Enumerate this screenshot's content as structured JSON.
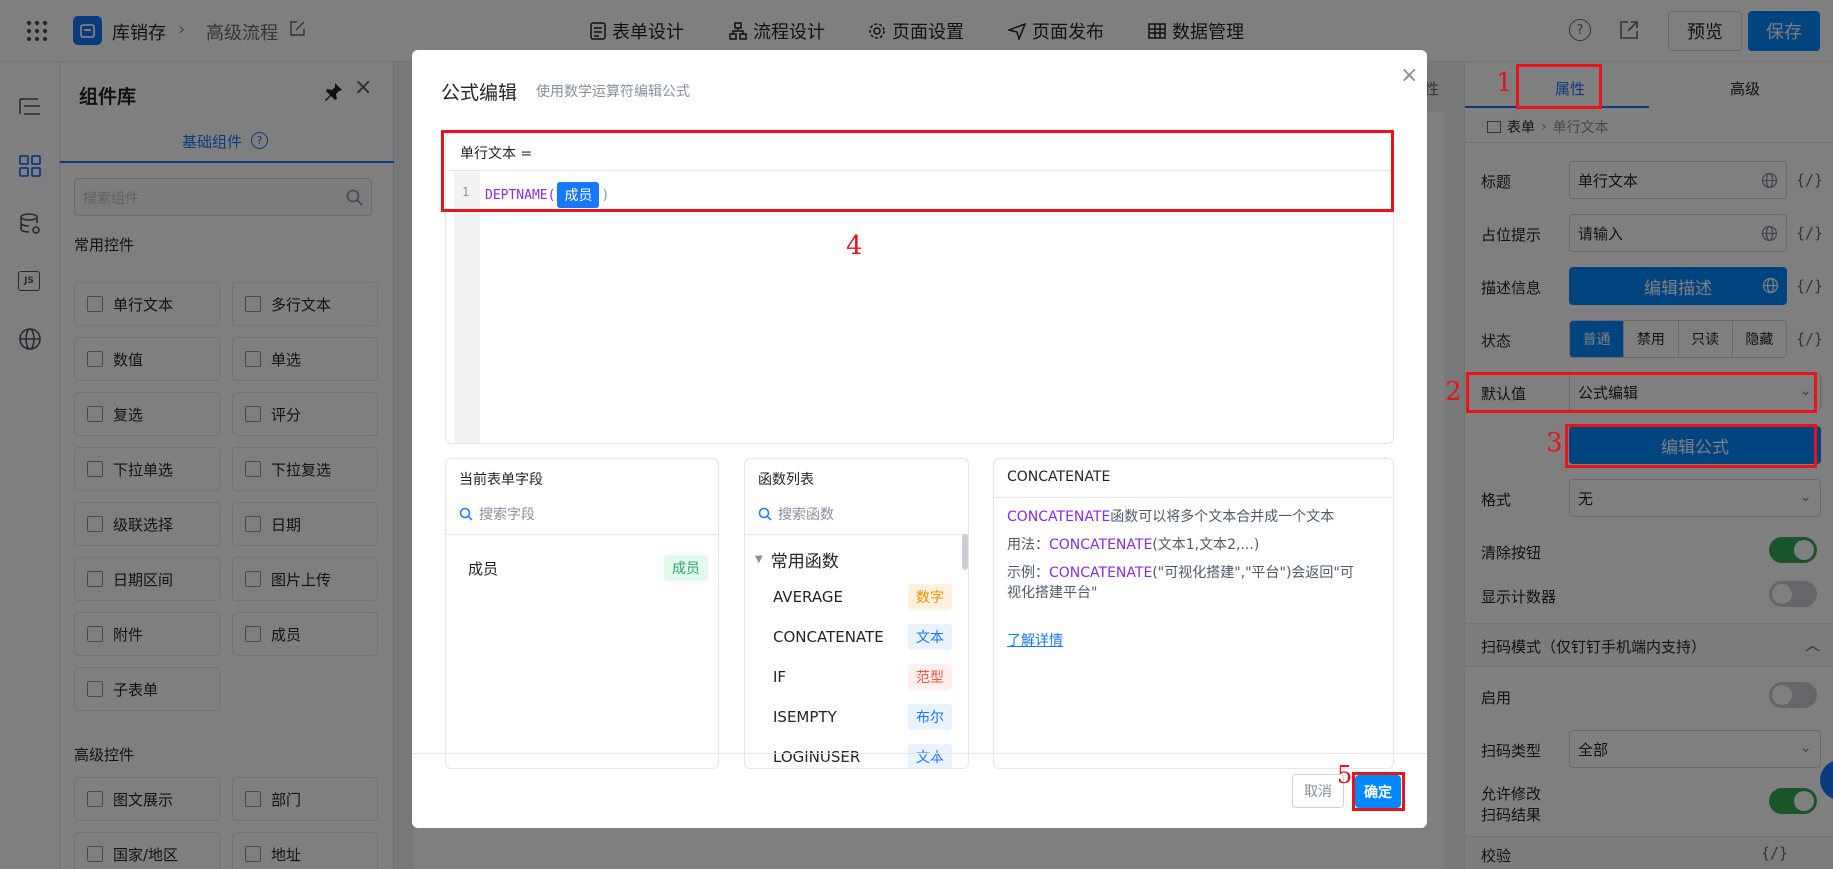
{
  "topbar": {
    "app_name": "库销存",
    "flow_name": "高级流程",
    "tabs": [
      "表单设计",
      "流程设计",
      "页面设置",
      "页面发布",
      "数据管理"
    ],
    "preview": "预览",
    "save": "保存"
  },
  "library": {
    "title": "组件库",
    "tab": "基础组件",
    "search_placeholder": "搜索组件",
    "common_title": "常用控件",
    "common": [
      "单行文本",
      "多行文本",
      "数值",
      "单选",
      "复选",
      "评分",
      "下拉单选",
      "下拉复选",
      "级联选择",
      "日期",
      "日期区间",
      "图片上传",
      "附件",
      "成员",
      "子表单"
    ],
    "advanced_title": "高级控件",
    "advanced": [
      "图文展示",
      "部门",
      "国家/地区",
      "地址"
    ]
  },
  "canvas": {
    "tab_fragment": "性"
  },
  "right": {
    "tabs": [
      "属性",
      "高级"
    ],
    "breadcrumb": [
      "表单",
      "单行文本"
    ],
    "title_label": "标题",
    "title_value": "单行文本",
    "placeholder_label": "占位提示",
    "placeholder_value": "请输入",
    "desc_label": "描述信息",
    "desc_button": "编辑描述",
    "state_label": "状态",
    "states": [
      "普通",
      "禁用",
      "只读",
      "隐藏"
    ],
    "default_label": "默认值",
    "default_value": "公式编辑",
    "edit_formula": "编辑公式",
    "format_label": "格式",
    "format_value": "无",
    "clear_label": "清除按钮",
    "counter_label": "显示计数器",
    "scan_section": "扫码模式（仅钉钉手机端内支持）",
    "enable_label": "启用",
    "scan_type_label": "扫码类型",
    "scan_type_value": "全部",
    "allow_edit_label_1": "允许修改",
    "allow_edit_label_2": "扫码结果",
    "verify_label": "校验",
    "fx": "{/}"
  },
  "modal": {
    "title": "公式编辑",
    "subtitle": "使用数学运算符编辑公式",
    "formula_header": "单行文本 =",
    "line_no": "1",
    "func_name": "DEPTNAME(",
    "chip": "成员",
    "close_paren": ")",
    "fields_title": "当前表单字段",
    "fields_search": "搜索字段",
    "field_name": "成员",
    "field_tag": "成员",
    "funcs_title": "函数列表",
    "funcs_search": "搜索函数",
    "group": "常用函数",
    "functions": [
      {
        "name": "AVERAGE",
        "tag": "数字",
        "tag_color": "#ff8800",
        "tag_bg": "#fff3e0"
      },
      {
        "name": "CONCATENATE",
        "tag": "文本",
        "tag_color": "#1677ff",
        "tag_bg": "#e8f3ff"
      },
      {
        "name": "IF",
        "tag": "范型",
        "tag_color": "#f5533d",
        "tag_bg": "#fff0ed"
      },
      {
        "name": "ISEMPTY",
        "tag": "布尔",
        "tag_color": "#1677ff",
        "tag_bg": "#e8f3ff"
      },
      {
        "name": "LOGINUSER",
        "tag": "文本",
        "tag_color": "#1677ff",
        "tag_bg": "#e8f3ff"
      }
    ],
    "desc_title": "CONCATENATE",
    "desc_fn": "CONCATENATE",
    "desc_text": "函数可以将多个文本合并成一个文本",
    "usage_prefix": "用法：",
    "usage_fn": "CONCATENATE",
    "usage_args": "(文本1,文本2,...)",
    "example_prefix": "示例：",
    "example_fn": "CONCATENATE",
    "example_text_1": "(\"可视化搭建\",\"平台\")会返回\"可",
    "example_text_2": "视化搭建平台\"",
    "learn_more": "了解详情",
    "cancel": "取消",
    "ok": "确定"
  },
  "annotations": [
    "1",
    "2",
    "3",
    "4",
    "5"
  ],
  "colors": {
    "primary": "#0089ff",
    "annotation": "#e8141a",
    "formula_purple": "#8a2be2"
  }
}
